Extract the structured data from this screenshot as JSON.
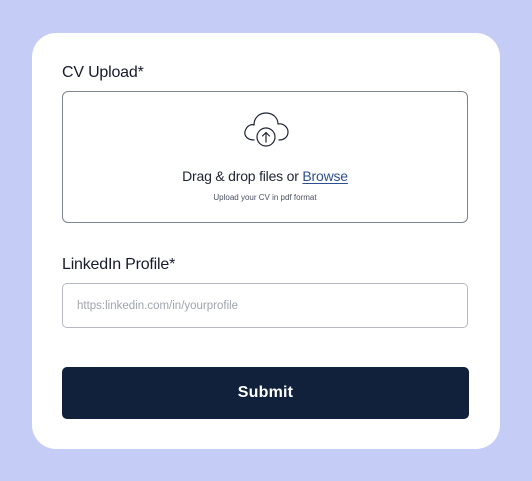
{
  "form": {
    "cv_label": "CV Upload*",
    "dropzone": {
      "icon": "cloud-upload-icon",
      "text_prefix": "Drag & drop files or ",
      "browse_label": "Browse",
      "hint": "Upload your CV in pdf format"
    },
    "linkedin_label": "LinkedIn Profile*",
    "linkedin_input": {
      "value": "",
      "placeholder": "https:linkedin.com/in/yourprofile"
    },
    "submit_label": "Submit"
  },
  "colors": {
    "background": "#c5cdf6",
    "card": "#ffffff",
    "button": "#12213b",
    "link": "#2d4f8f"
  }
}
